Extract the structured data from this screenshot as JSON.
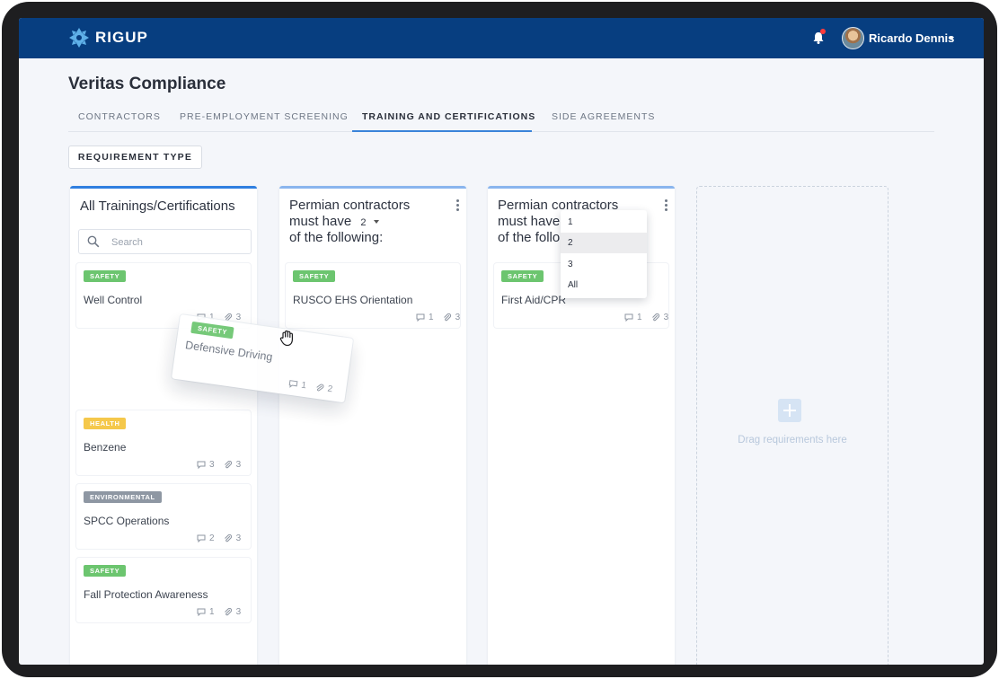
{
  "header": {
    "brand": "RIGUP",
    "user_name": "Ricardo Dennis"
  },
  "page": {
    "title": "Veritas Compliance",
    "tabs": [
      {
        "label": "CONTRACTORS"
      },
      {
        "label": "PRE-EMPLOYMENT SCREENING"
      },
      {
        "label": "TRAINING AND CERTIFICATIONS"
      },
      {
        "label": "SIDE AGREEMENTS"
      }
    ],
    "active_tab": "TRAINING AND CERTIFICATIONS",
    "requirement_button": "REQUIREMENT TYPE"
  },
  "columns": {
    "all": {
      "title": "All Trainings/Certifications",
      "search_placeholder": "Search",
      "cards": [
        {
          "badge": "SAFETY",
          "title": "Well Control",
          "comments": "1",
          "attachments": "3"
        },
        {
          "badge": "HEALTH",
          "title": "Benzene",
          "comments": "3",
          "attachments": "3"
        },
        {
          "badge": "ENVIRONMENTAL",
          "title": "SPCC Operations",
          "comments": "2",
          "attachments": "3"
        },
        {
          "badge": "SAFETY",
          "title": "Fall Protection Awareness",
          "comments": "1",
          "attachments": "3"
        }
      ]
    },
    "group1": {
      "title_line1": "Permian contractors",
      "title_line2": "must have",
      "count": "2",
      "title_line3": "of the following:",
      "cards": [
        {
          "badge": "SAFETY",
          "title": "RUSCO EHS Orientation",
          "comments": "1",
          "attachments": "3"
        }
      ]
    },
    "group2": {
      "title_line1": "Permian contractors",
      "title_line2": "must have",
      "title_line3": "of the follo",
      "cards": [
        {
          "badge": "SAFETY",
          "title": "First Aid/CPR",
          "comments": "1",
          "attachments": "3"
        }
      ]
    }
  },
  "dragged_card": {
    "badge": "SAFETY",
    "title": "Defensive Driving",
    "comments": "1",
    "attachments": "2"
  },
  "count_dropdown": {
    "options": [
      "1",
      "2",
      "3",
      "All"
    ],
    "selected": "2"
  },
  "dropzone": {
    "text": "Drag requirements here"
  },
  "colors": {
    "topbar": "#073e80",
    "accent": "#3a84d9",
    "safety": "#6cc56f",
    "health": "#f5c84b",
    "environmental": "#8e97a3"
  }
}
